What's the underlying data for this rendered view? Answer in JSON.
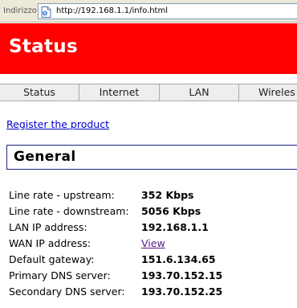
{
  "browser": {
    "address_label": "Indirizzo",
    "url": "http://192.168.1.1/info.html"
  },
  "header": {
    "title": "Status",
    "background_color": "#ff0000"
  },
  "tabs": [
    {
      "label": "Status"
    },
    {
      "label": "Internet"
    },
    {
      "label": "LAN"
    },
    {
      "label": "Wireles"
    }
  ],
  "register_link": "Register the product",
  "section": {
    "title": "General",
    "border_color": "#1a237e"
  },
  "info_rows": [
    {
      "label": "Line rate - upstream:",
      "value": "352 Kbps"
    },
    {
      "label": "Line rate - downstream:",
      "value": "5056 Kbps"
    },
    {
      "label": "LAN IP address:",
      "value": "192.168.1.1"
    },
    {
      "label": "WAN IP address:",
      "value": "View"
    },
    {
      "label": "Default gateway:",
      "value": "151.6.134.65"
    },
    {
      "label": "Primary DNS server:",
      "value": "193.70.152.15"
    },
    {
      "label": "Secondary DNS server:",
      "value": "193.70.152.25"
    }
  ],
  "icons": {
    "page": "page-icon"
  }
}
